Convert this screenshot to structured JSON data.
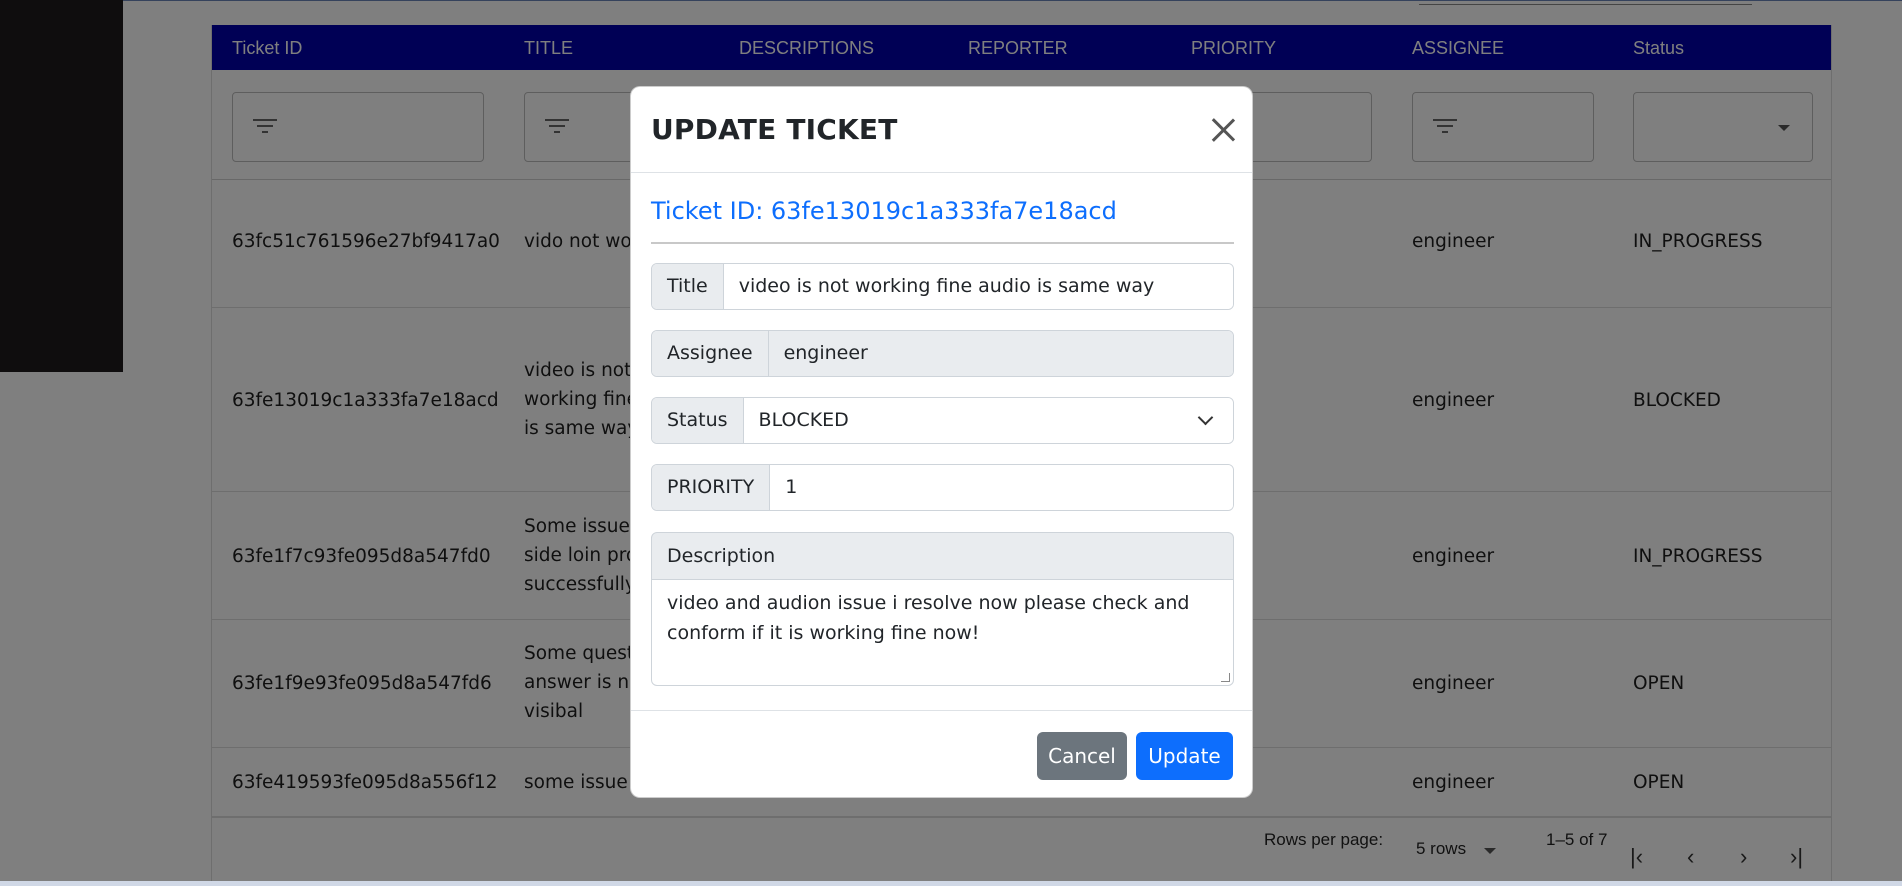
{
  "table": {
    "headers": [
      "Ticket ID",
      "TITLE",
      "DESCRIPTIONS",
      "REPORTER",
      "PRIORITY",
      "ASSIGNEE",
      "Status"
    ],
    "rows": [
      {
        "id": "63fc51c761596e27bf9417a0",
        "title": "vido not wo",
        "assignee": "engineer",
        "status": "IN_PROGRESS"
      },
      {
        "id": "63fe13019c1a333fa7e18acd",
        "title_lines": [
          "video is not",
          "working fine",
          "is same way"
        ],
        "assignee": "engineer",
        "status": "BLOCKED"
      },
      {
        "id": "63fe1f7c93fe095d8a547fd0",
        "title_lines": [
          "Some issue",
          "side loin pro",
          "successfully"
        ],
        "assignee": "engineer",
        "status": "IN_PROGRESS"
      },
      {
        "id": "63fe1f9e93fe095d8a547fd6",
        "title_lines": [
          "Some quest",
          "answer is no",
          "visibal"
        ],
        "assignee": "engineer",
        "status": "OPEN"
      },
      {
        "id": "63fe419593fe095d8a556f12",
        "title": "some issue",
        "assignee": "engineer",
        "status": "OPEN"
      }
    ]
  },
  "pagination": {
    "rows_per_page_label": "Rows per page:",
    "rows_per_page_value": "5 rows",
    "range": "1–5 of 7"
  },
  "modal": {
    "title": "UPDATE TICKET",
    "ticket_id_text": "Ticket ID: 63fe13019c1a333fa7e18acd",
    "fields": {
      "title_label": "Title",
      "title_value": "video is not  working fine audio is same way",
      "assignee_label": "Assignee",
      "assignee_value": "engineer",
      "status_label": "Status",
      "status_value": "BLOCKED",
      "priority_label": "PRIORITY",
      "priority_value": "1",
      "description_label": "Description",
      "description_value": "video and audion issue i resolve now please check and conform if it is working fine now!"
    },
    "buttons": {
      "cancel": "Cancel",
      "update": "Update"
    }
  },
  "colors": {
    "table_header": "#0000aa",
    "primary": "#0d6efd",
    "secondary": "#6c757d"
  }
}
